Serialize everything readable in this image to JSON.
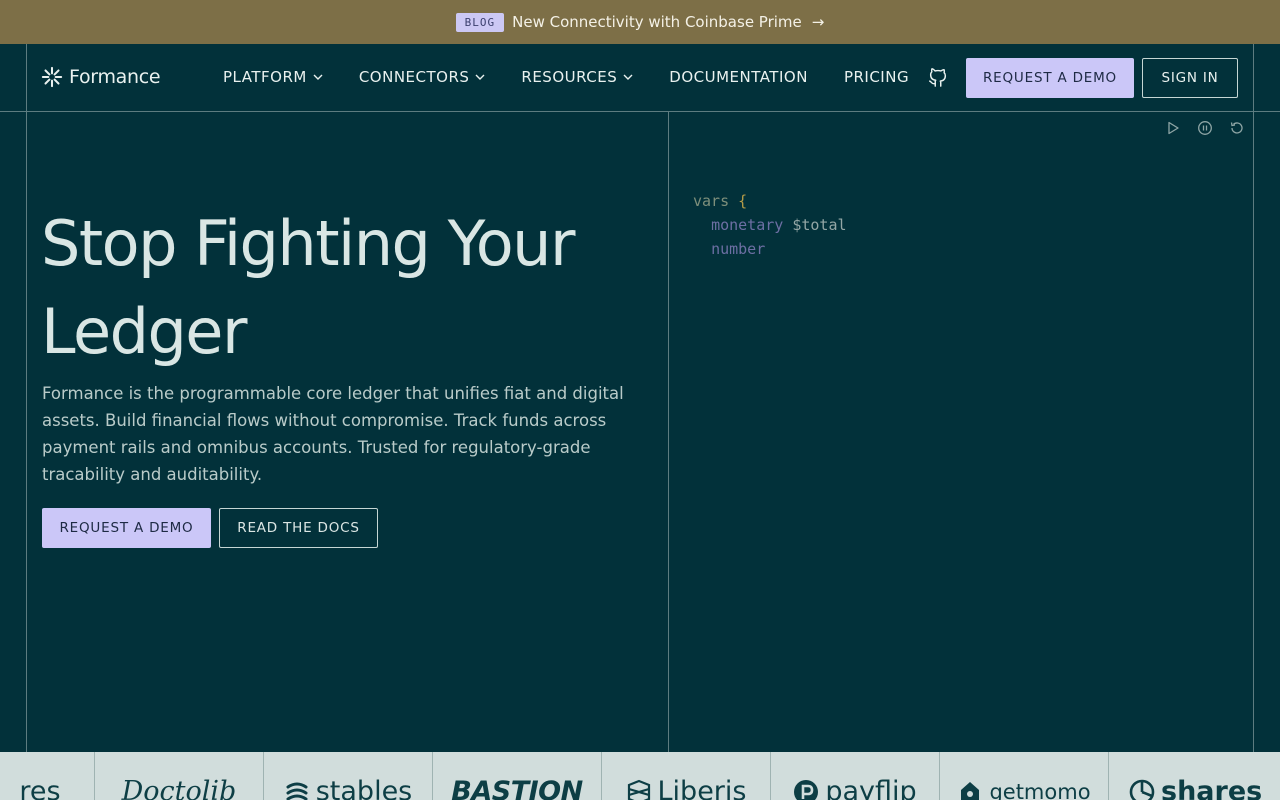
{
  "banner": {
    "badge": "BLOG",
    "text": "New Connectivity with Coinbase Prime",
    "arrow": "→"
  },
  "nav": {
    "logo": "Formance",
    "items": [
      {
        "label": "PLATFORM",
        "dropdown": true
      },
      {
        "label": "CONNECTORS",
        "dropdown": true
      },
      {
        "label": "RESOURCES",
        "dropdown": true
      },
      {
        "label": "DOCUMENTATION",
        "dropdown": false
      },
      {
        "label": "PRICING",
        "dropdown": false
      }
    ],
    "github_icon": "github-icon",
    "request_demo": "REQUEST A DEMO",
    "sign_in": "SIGN IN"
  },
  "hero": {
    "title_line1": "Stop Fighting Your",
    "title_line2": "Ledger",
    "description": "Formance is the programmable core ledger that unifies fiat and digital assets. Build financial flows without compromise. Track funds across payment rails and omnibus accounts. Trusted for regulatory-grade tracability and auditability.",
    "cta_primary": "REQUEST A DEMO",
    "cta_secondary": "READ THE DOCS"
  },
  "code": {
    "l1_kw": "vars",
    "l1_brace": "{",
    "l2_type": "monetary",
    "l2_var": "$total",
    "l3_type": "number"
  },
  "controls": [
    "play-icon",
    "pause-icon",
    "restart-icon"
  ],
  "logos": [
    "res",
    "Doctolib",
    "stables",
    "BASTION",
    "Liberis",
    "payflip",
    "getmomo",
    "shares"
  ],
  "colors": {
    "background": "#02313a",
    "banner": "#7d6f47",
    "accent": "#cbc7f8"
  }
}
